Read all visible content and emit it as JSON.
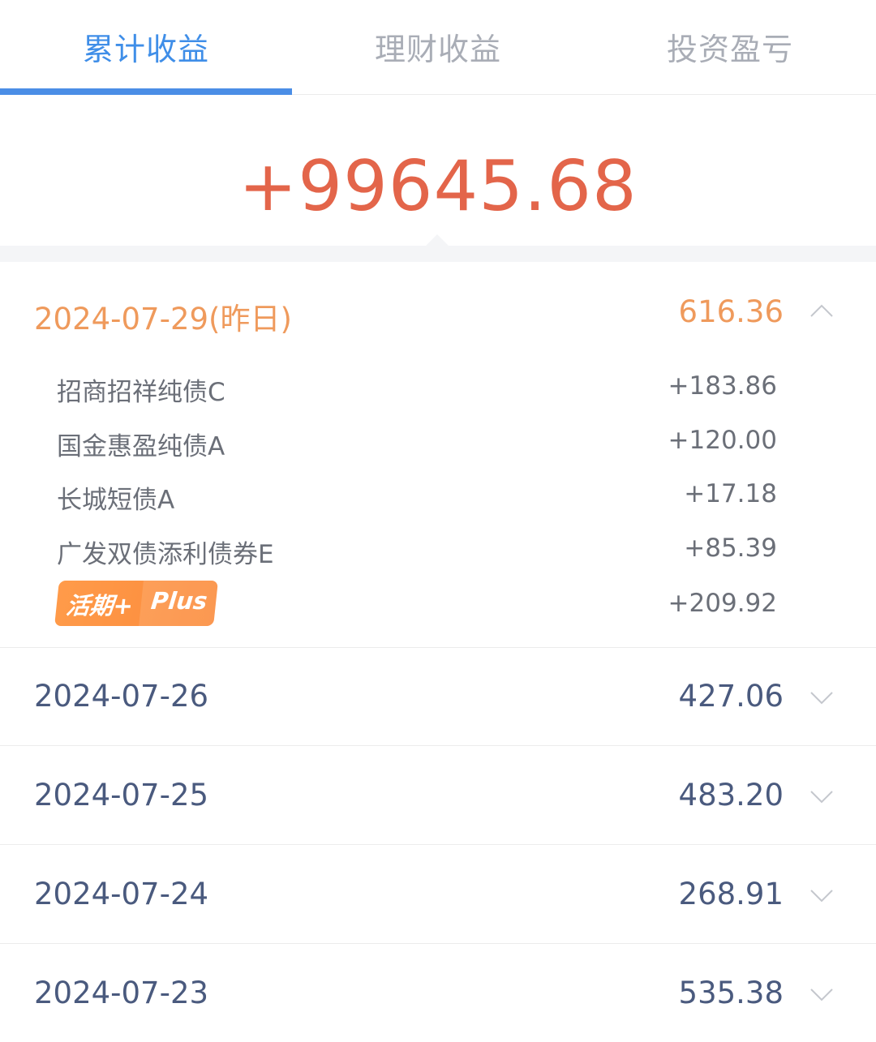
{
  "tabs": [
    {
      "label": "累计收益",
      "active": true
    },
    {
      "label": "理财收益",
      "active": false
    },
    {
      "label": "投资盈亏",
      "active": false
    }
  ],
  "summary": {
    "total": "+99645.68"
  },
  "colors": {
    "accent_blue": "#4b8ee6",
    "total_red": "#e3654a",
    "expanded_orange": "#ef9a5c",
    "date_navy": "#4a5a7e"
  },
  "days": [
    {
      "date": "2024-07-29(昨日)",
      "amount": "616.36",
      "expanded": true,
      "icon": "chevron-up-icon",
      "funds": [
        {
          "name": "招商招祥纯债C",
          "value": "+183.86"
        },
        {
          "name": "国金惠盈纯债A",
          "value": "+120.00"
        },
        {
          "name": "长城短债A",
          "value": "+17.18"
        },
        {
          "name": "广发双债添利债券E",
          "value": "+85.39"
        }
      ],
      "plus_item": {
        "badge_part1": "活期+",
        "badge_part2": "Plus",
        "value": "+209.92"
      }
    },
    {
      "date": "2024-07-26",
      "amount": "427.06",
      "expanded": false,
      "icon": "chevron-down-icon"
    },
    {
      "date": "2024-07-25",
      "amount": "483.20",
      "expanded": false,
      "icon": "chevron-down-icon"
    },
    {
      "date": "2024-07-24",
      "amount": "268.91",
      "expanded": false,
      "icon": "chevron-down-icon"
    },
    {
      "date": "2024-07-23",
      "amount": "535.38",
      "expanded": false,
      "icon": "chevron-down-icon"
    }
  ]
}
